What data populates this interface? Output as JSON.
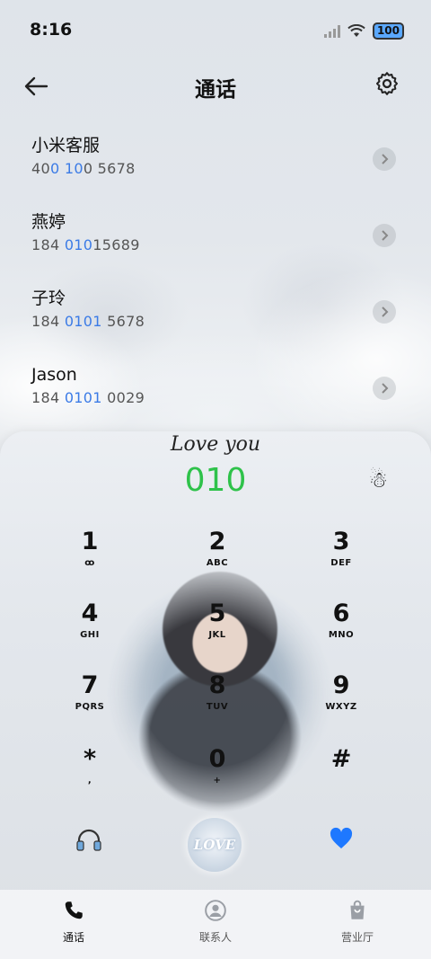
{
  "status_bar": {
    "time": "8:16",
    "battery": "100"
  },
  "header": {
    "title": "通话"
  },
  "contacts": [
    {
      "name": "小米客服",
      "num_a": "40",
      "num_b": "0",
      "num_c": " ",
      "num_d": "10",
      "num_e": "0 5678"
    },
    {
      "name": "燕婷",
      "num_a": "184 ",
      "num_b": "010",
      "num_c": "",
      "num_d": "",
      "num_e": "15689"
    },
    {
      "name": "子玲",
      "num_a": "184 ",
      "num_b": "0101",
      "num_c": "",
      "num_d": "",
      "num_e": " 5678"
    },
    {
      "name": "Jason",
      "num_a": "184 ",
      "num_b": "0101",
      "num_c": "",
      "num_d": "",
      "num_e": " 0029"
    }
  ],
  "dialpad": {
    "decoration": "Love you",
    "dialed_number": "010",
    "keys": [
      {
        "digit": "1",
        "letters": "ꝏ"
      },
      {
        "digit": "2",
        "letters": "ABC"
      },
      {
        "digit": "3",
        "letters": "DEF"
      },
      {
        "digit": "4",
        "letters": "GHI"
      },
      {
        "digit": "5",
        "letters": "JKL"
      },
      {
        "digit": "6",
        "letters": "MNO"
      },
      {
        "digit": "7",
        "letters": "PQRS"
      },
      {
        "digit": "8",
        "letters": "TUV"
      },
      {
        "digit": "9",
        "letters": "WXYZ"
      },
      {
        "digit": "*",
        "letters": ","
      },
      {
        "digit": "0",
        "letters": "+"
      },
      {
        "digit": "#",
        "letters": ""
      }
    ],
    "call_button_text": "LOVE"
  },
  "tabs": [
    {
      "label": "通话",
      "icon": "phone-icon"
    },
    {
      "label": "联系人",
      "icon": "person-icon"
    },
    {
      "label": "营业厅",
      "icon": "bag-icon"
    }
  ],
  "colors": {
    "dialed": "#2ec24a",
    "highlight": "#3b7be6",
    "heart": "#1e78ff"
  }
}
